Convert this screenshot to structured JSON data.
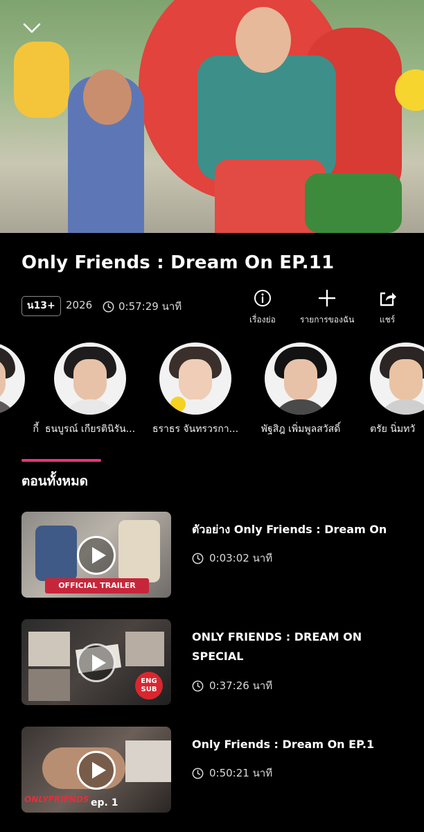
{
  "video": {
    "title": "Only Friends : Dream On EP.11",
    "rating": "น13+",
    "year": "2026",
    "duration": "0:57:29 นาที"
  },
  "actions": [
    {
      "label": "เรื่องย่อ",
      "icon": "info-icon"
    },
    {
      "label": "รายการของฉัน",
      "icon": "plus-icon"
    },
    {
      "label": "แชร์",
      "icon": "share-icon"
    }
  ],
  "cast": [
    {
      "name": "กี้"
    },
    {
      "name": "ธนบูรณ์ เกียรตินิรัน..."
    },
    {
      "name": "ธราธร จันทรวรกา..."
    },
    {
      "name": "พัฐสิฎ เพิ่มพูลสวัสดิ์"
    },
    {
      "name": "ตรัย นิ่มทวั"
    }
  ],
  "section": {
    "title": "ตอนทั้งหมด"
  },
  "episodes": [
    {
      "title": "ตัวอย่าง Only Friends : Dream On",
      "duration": "0:03:02 นาที",
      "thumb_text": "OFFICIAL TRAILER"
    },
    {
      "title": "ONLY FRIENDS : DREAM ON SPECIAL",
      "duration": "0:37:26 นาที",
      "thumb_text": "ENG SUB"
    },
    {
      "title": "Only Friends : Dream On EP.1",
      "duration": "0:50:21 นาที",
      "thumb_text": "ep. 1"
    }
  ],
  "colors": {
    "accent": "#e8337f",
    "background": "#000000"
  }
}
